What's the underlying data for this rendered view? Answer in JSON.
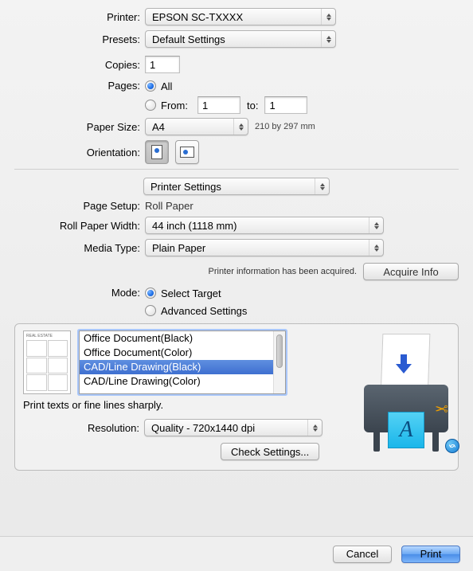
{
  "labels": {
    "printer": "Printer:",
    "presets": "Presets:",
    "copies": "Copies:",
    "pages": "Pages:",
    "all": "All",
    "from": "From:",
    "to": "to:",
    "paper_size": "Paper Size:",
    "orientation": "Orientation:",
    "page_setup": "Page Setup:",
    "roll_paper_width": "Roll Paper Width:",
    "media_type": "Media Type:",
    "mode": "Mode:",
    "select_target": "Select Target",
    "advanced_settings": "Advanced Settings",
    "resolution": "Resolution:"
  },
  "values": {
    "printer": "EPSON SC-TXXXX",
    "presets": "Default Settings",
    "copies": "1",
    "from": "1",
    "to": "1",
    "paper_size": "A4",
    "paper_dim": "210 by 297 mm",
    "section_dropdown": "Printer Settings",
    "page_setup": "Roll Paper",
    "roll_paper_width": "44 inch (1118 mm)",
    "media_type": "Plain Paper",
    "resolution": "Quality - 720x1440 dpi"
  },
  "info": {
    "acquired": "Printer information has been acquired.",
    "acquire_btn": "Acquire Info"
  },
  "target_list": {
    "items": [
      "Office Document(Black)",
      "Office Document(Color)",
      "CAD/Line Drawing(Black)",
      "CAD/Line Drawing(Color)"
    ],
    "selected_index": 2,
    "description": "Print texts or fine lines sharply."
  },
  "buttons": {
    "check_settings": "Check Settings...",
    "cancel": "Cancel",
    "print": "Print"
  },
  "thumb_title": "REAL ESTATE"
}
